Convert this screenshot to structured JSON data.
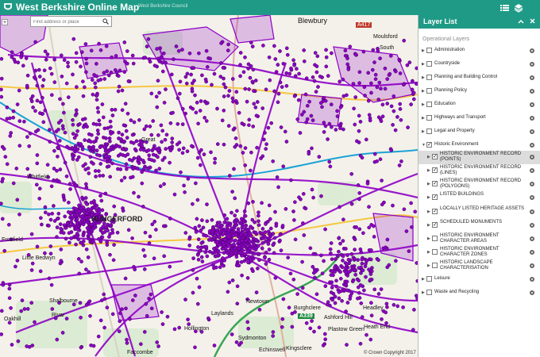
{
  "header": {
    "title": "West Berkshire Online Map",
    "subtitle": "West Berkshire Council",
    "icons": [
      "list-icon",
      "layers-icon"
    ]
  },
  "search": {
    "placeholder": "Find address or place",
    "icon": "search-icon"
  },
  "map": {
    "places": [
      "Blewbury",
      "Moulsford",
      "South",
      "A417",
      "Whitfield",
      "HUNGERFORD",
      "Froxfield",
      "Little Bedwyn",
      "Shalbourne",
      "Rivar",
      "Oakhill",
      "Burghclere",
      "Headley",
      "Newtown",
      "Echinswell",
      "Laylands",
      "Sydmonton",
      "Kingsclere",
      "Ashford Hill",
      "Plastow Green",
      "Hollington",
      "Faccombe",
      "A339",
      "Great",
      "Heath End"
    ],
    "accent_color": "#8e00c7",
    "road_color": "#1aa3d6",
    "copyright": "© Crown Copyright 2017"
  },
  "layer_panel": {
    "title": "Layer List",
    "section_label": "Operational Layers",
    "layers": [
      {
        "label": "Administration",
        "checked": false,
        "level": 0
      },
      {
        "label": "Countryside",
        "checked": false,
        "level": 0
      },
      {
        "label": "Planning and Building Control",
        "checked": false,
        "level": 0
      },
      {
        "label": "Planning Policy",
        "checked": false,
        "level": 0
      },
      {
        "label": "Education",
        "checked": false,
        "level": 0
      },
      {
        "label": "Highways and Transport",
        "checked": false,
        "level": 0
      },
      {
        "label": "Legal and Property",
        "checked": false,
        "level": 0
      },
      {
        "label": "Historic Environment",
        "checked": true,
        "level": 0
      },
      {
        "label": "HISTORIC ENVIRONMENT RECORD (POINTS)",
        "checked": true,
        "level": 1,
        "selected": true
      },
      {
        "label": "HISTORIC ENVIRONMENT RECORD (LINES)",
        "checked": true,
        "level": 1
      },
      {
        "label": "HISTORIC ENVIRONMENT RECORD (POLYGONS)",
        "checked": true,
        "level": 1
      },
      {
        "label": "LISTED BUILDINGS",
        "checked": true,
        "level": 1
      },
      {
        "label": "LOCALLY LISTED HERITAGE ASSETS",
        "checked": true,
        "level": 1
      },
      {
        "label": "SCHEDULED MONUMENTS",
        "checked": true,
        "level": 1
      },
      {
        "label": "HISTORIC ENVIRONMENT CHARACTER AREAS",
        "checked": false,
        "level": 1
      },
      {
        "label": "HISTORIC ENVIRONMENT CHARACTER ZONES",
        "checked": false,
        "level": 1
      },
      {
        "label": "HISTORIC LANDSCAPE CHARACTERISATION",
        "checked": false,
        "level": 1
      },
      {
        "label": "Leisure",
        "checked": false,
        "level": 0
      },
      {
        "label": "Waste and Recycling",
        "checked": false,
        "level": 0
      }
    ]
  }
}
